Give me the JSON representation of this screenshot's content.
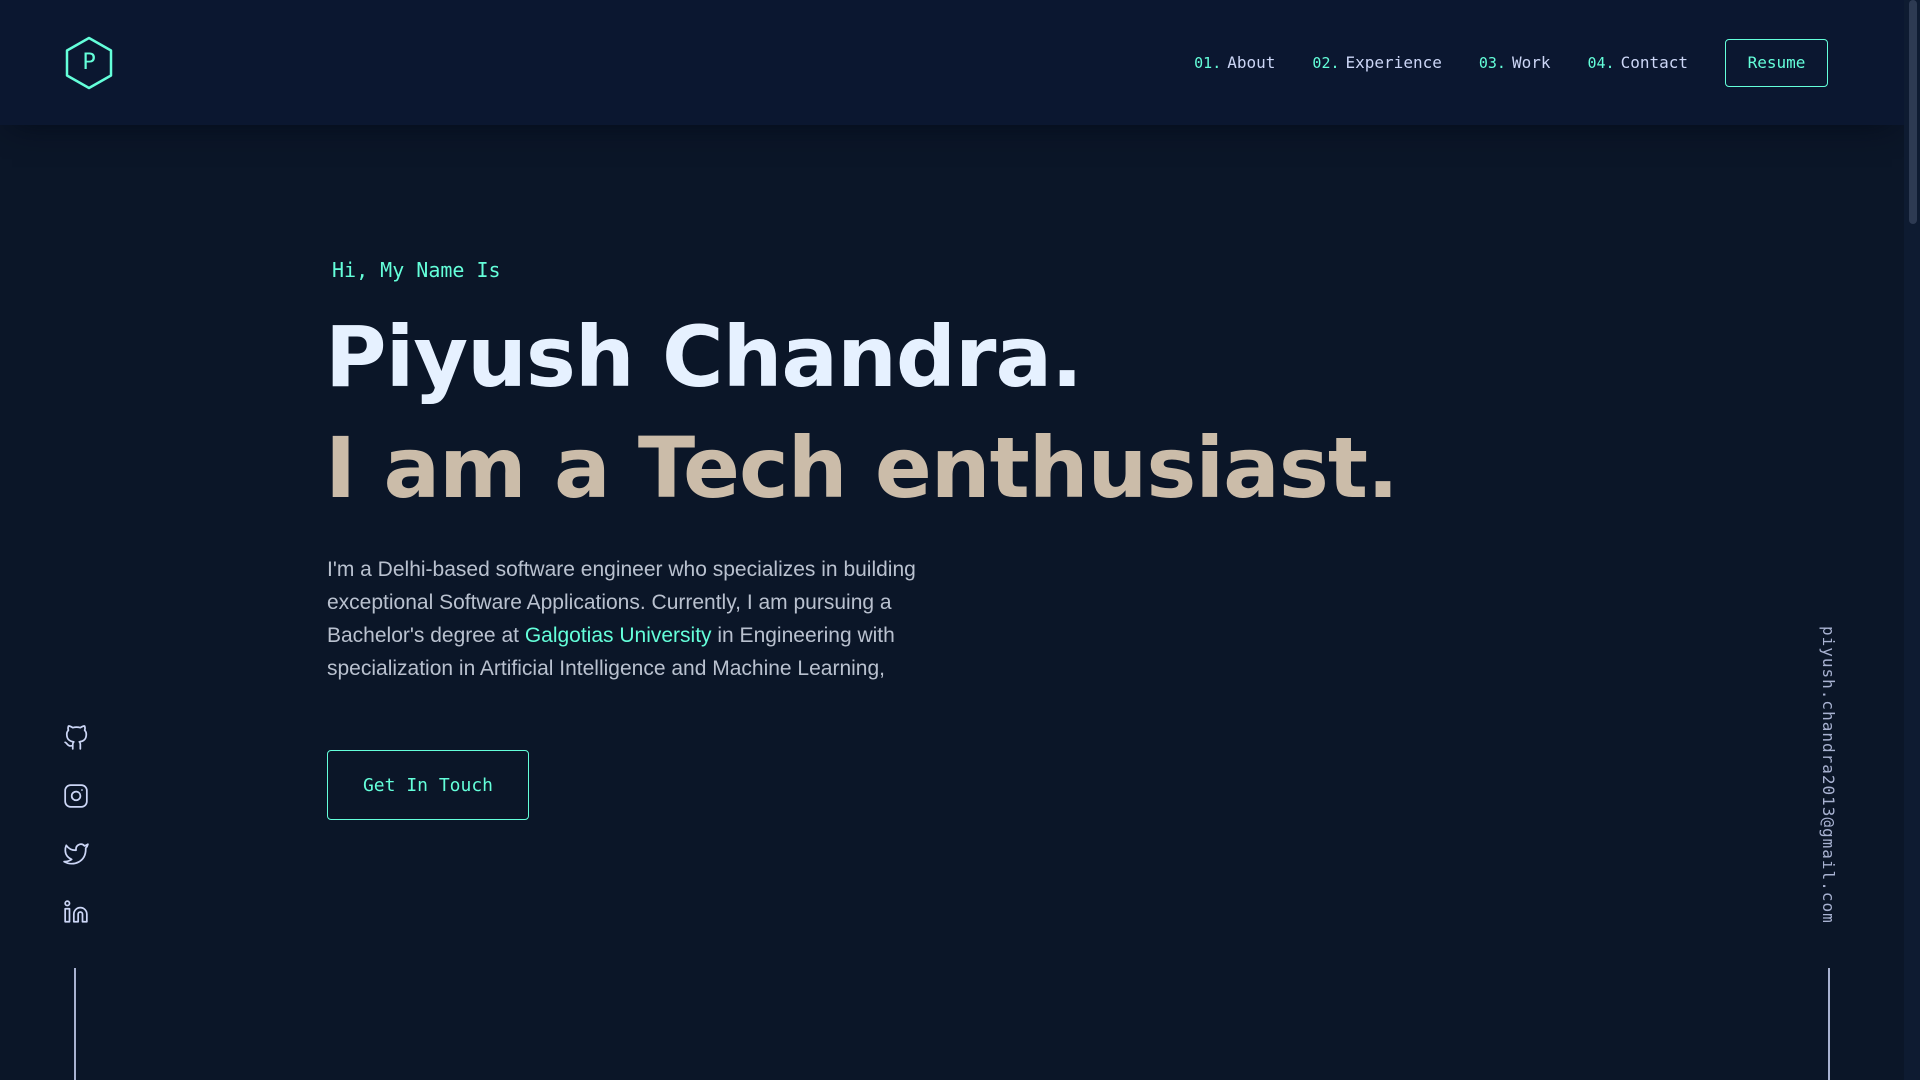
{
  "header": {
    "logo_letter": "P",
    "nav": [
      {
        "num": "01.",
        "label": "About"
      },
      {
        "num": "02.",
        "label": "Experience"
      },
      {
        "num": "03.",
        "label": "Work"
      },
      {
        "num": "04.",
        "label": "Contact"
      }
    ],
    "resume_label": "Resume"
  },
  "hero": {
    "greeting": "Hi, My Name Is",
    "name": "Piyush Chandra.",
    "tagline": "I am a Tech enthusiast.",
    "bio_before": "I'm a Delhi-based software engineer who specializes in building exceptional Software Applications. Currently, I am pursuing a Bachelor's degree at ",
    "bio_link": "Galgotias University",
    "bio_after": " in Engineering with specialization in Artificial Intelligence and Machine Learning,",
    "cta_label": "Get In Touch"
  },
  "socials": [
    {
      "icon": "github-icon"
    },
    {
      "icon": "instagram-icon"
    },
    {
      "icon": "twitter-icon"
    },
    {
      "icon": "linkedin-icon"
    }
  ],
  "email": "piyush.chandra2013@gmail.com",
  "colors": {
    "background": "#0b1628",
    "accent": "#64ffda",
    "heading": "#e6f1ff",
    "tagline": "#cbbca9",
    "body_text": "#b9c1cf"
  }
}
